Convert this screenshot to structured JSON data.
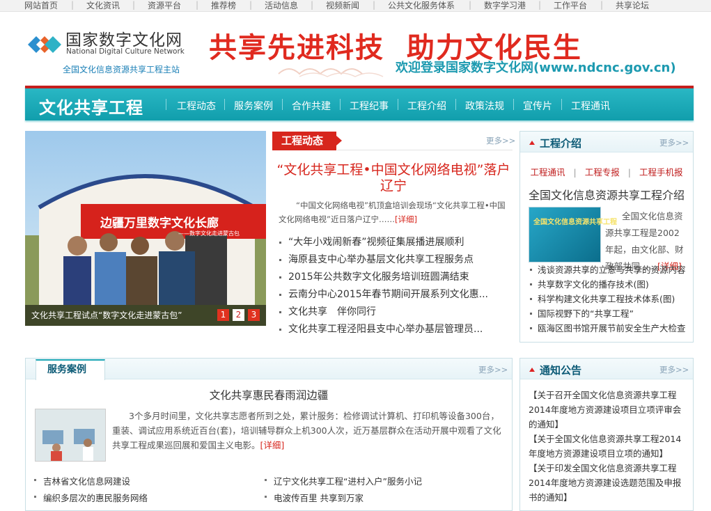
{
  "top_nav": [
    "网站首页",
    "文化资讯",
    "资源平台",
    "推荐榜",
    "活动信息",
    "视频新闻",
    "公共文化服务体系",
    "数字学习港",
    "工作平台",
    "共享论坛"
  ],
  "logo": {
    "cn": "国家数字文化网",
    "en": "National Digital Culture Network",
    "sub": "全国文化信息资源共享工程主站"
  },
  "banner": {
    "slogan": "共享先进科技  助力文化民生",
    "welcome": "欢迎登录国家数字文化网(www.ndcnc.gov.cn)"
  },
  "main_nav": {
    "title": "文化共享工程",
    "links": [
      "工程动态",
      "服务案例",
      "合作共建",
      "工程纪事",
      "工程介绍",
      "政策法规",
      "宣传片",
      "工程通讯"
    ]
  },
  "slideshow": {
    "caption": "文化共享工程试点“数字文化走进蒙古包”",
    "pages": [
      "1",
      "2",
      "3"
    ],
    "active_page": 2,
    "banner_text": "边疆万里数字文化长廊",
    "banner_sub": "——数字文化走进蒙古包"
  },
  "news": {
    "tab": "工程动态",
    "more": "更多>>",
    "headline": "“文化共享工程•中国文化网络电视”落户辽宁",
    "summary": "“中国文化网络电视”机顶盒培训会现场“文化共享工程•中国文化网络电视”近日落户辽宁……",
    "detail": "[详细]",
    "items": [
      "“大年小戏闹新春”视频征集展播进展顺利",
      "海原县支中心举办基层文化共享工程服务点",
      "2015年公共数字文化服务培训班圆满结束",
      "云南分中心2015年春节期间开展系列文化惠...",
      "文化共享　伴你同行",
      "文化共享工程泾阳县支中心举办基层管理员..."
    ]
  },
  "intro": {
    "title": "工程介绍",
    "more": "更多>>",
    "links": [
      "工程通讯",
      "工程专报",
      "工程手机报"
    ],
    "heading": "全国文化信息资源共享工程介绍",
    "image_text": "全国文化信息资源共享工程",
    "text": "全国文化信息资源共享工程是2002年起，由文化部、财政部共同……",
    "detail": "[详细]",
    "items": [
      "浅谈资源共享的立意与共享的资源内容",
      "共享数字文化的播存技术(图)",
      "科学构建文化共享工程技术体系(图)",
      "国际视野下的“共享工程”",
      "瓯海区图书馆开展节前安全生产大检查"
    ]
  },
  "service": {
    "tab": "服务案例",
    "more": "更多>>",
    "title": "文化共享惠民春雨润边疆",
    "text": "3个多月时间里，文化共享志愿者所到之处，累计服务：检修调试计算机、打印机等设备300台，重装、调试应用系统近百台(套)，培训辅导群众上机300人次，近万基层群众在活动开展中观看了文化共享工程成果巡回展和爱国主义电影。",
    "detail": "[详细]",
    "items": [
      "吉林省文化信息网建设",
      "辽宁文化共享工程“进村入户”服务小记",
      "编织多层次的惠民服务网络",
      "电波传百里 共享到万家"
    ]
  },
  "notice": {
    "title": "通知公告",
    "more": "更多>>",
    "items": [
      "【关于召开全国文化信息资源共享工程2014年度地方资源建设项目立项评审会的通知】",
      "【关于全国文化信息资源共享工程2014年度地方资源建设项目立项的通知】",
      "【关于印发全国文化信息资源共享工程2014年度地方资源建设选题范围及申报书的通知】"
    ]
  },
  "colors": {
    "red": "#d7261d",
    "teal": "#1aa9b7",
    "link_blue": "#0a5975"
  }
}
